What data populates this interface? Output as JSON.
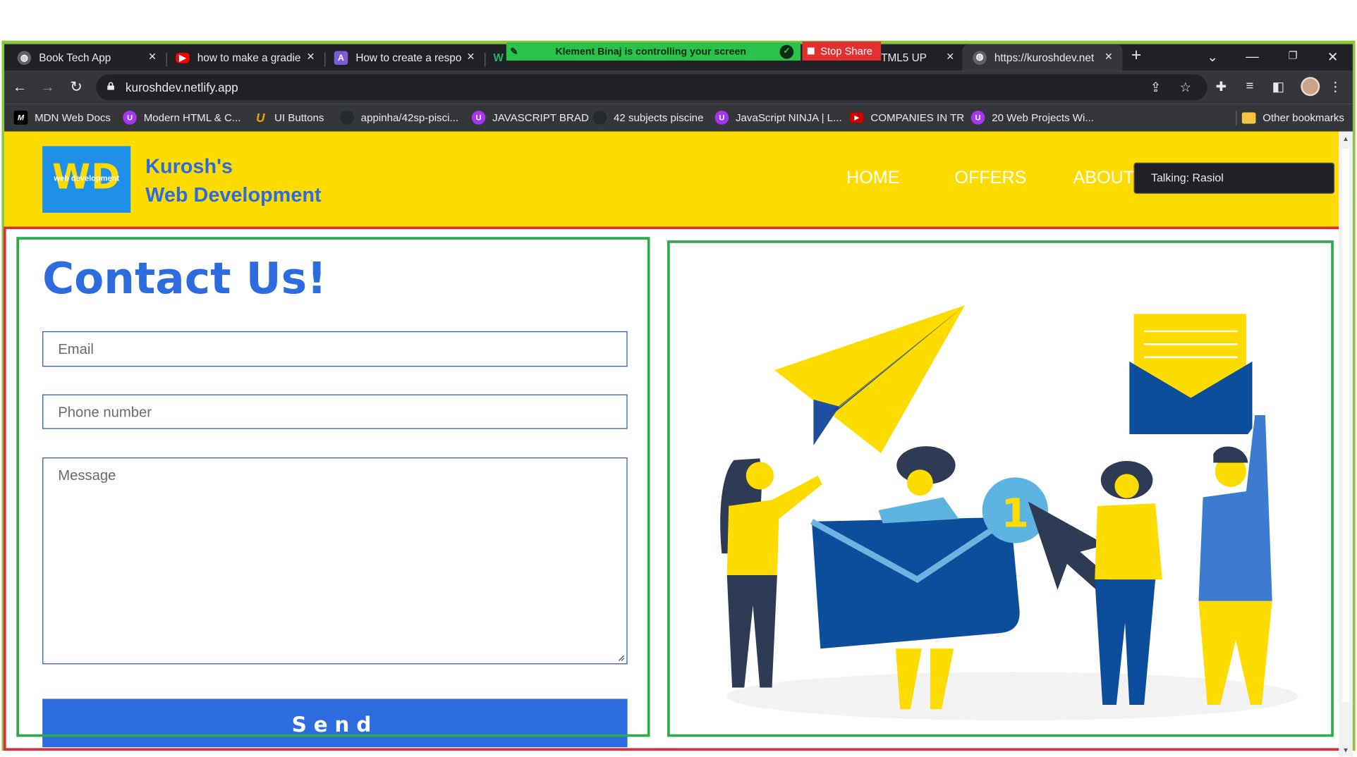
{
  "browser": {
    "tabs": [
      {
        "title": "Book Tech App",
        "favicon": "globe-icon"
      },
      {
        "title": "how to make a gradie",
        "favicon": "youtube-icon"
      },
      {
        "title": "How to create a respo",
        "favicon": "rocket-icon"
      },
      {
        "title": "W",
        "favicon": "w-icon"
      },
      {
        "title": "TML5 UP",
        "favicon": "html5up-icon"
      },
      {
        "title": "https://kuroshdev.net",
        "favicon": "globe-icon"
      }
    ],
    "new_tab_label": "+",
    "url": "kuroshdev.netlify.app",
    "bookmarks": [
      {
        "label": "MDN Web Docs",
        "icon": "mdn-icon"
      },
      {
        "label": "Modern HTML & C...",
        "icon": "udemy-icon"
      },
      {
        "label": "UI Buttons",
        "icon": "ui-icon"
      },
      {
        "label": "appinha/42sp-pisci...",
        "icon": "github-icon"
      },
      {
        "label": "JAVASCRIPT BRAD",
        "icon": "udemy-icon"
      },
      {
        "label": "42 subjects piscine",
        "icon": "github-icon"
      },
      {
        "label": "JavaScript NINJA | L...",
        "icon": "udemy-icon"
      },
      {
        "label": "COMPANIES IN TR",
        "icon": "youtube-icon"
      },
      {
        "label": "20 Web Projects Wi...",
        "icon": "udemy-icon"
      }
    ],
    "other_bookmarks": "Other bookmarks"
  },
  "share": {
    "banner": "Klement Binaj is controlling your screen",
    "stop_label": "Stop Share",
    "talking": "Talking: Rasiol",
    "share_color": "#2bc24b",
    "stop_color": "#e03030"
  },
  "site": {
    "logo_text": "WD",
    "logo_subtext": "web development",
    "brand_line1": "Kurosh's",
    "brand_line2": "Web Development",
    "nav": [
      "HOME",
      "OFFERS",
      "ABOUT"
    ],
    "header_color": "#ffdc00",
    "accent_color": "#2d6cdf"
  },
  "contact": {
    "title": "Contact Us!",
    "email_placeholder": "Email",
    "phone_placeholder": "Phone number",
    "message_placeholder": "Message",
    "send_label": "Send"
  },
  "illustration": {
    "badge_number": "1"
  },
  "annotations": {
    "red_color": "#dd2d3a",
    "green_color": "#2bab4e"
  }
}
